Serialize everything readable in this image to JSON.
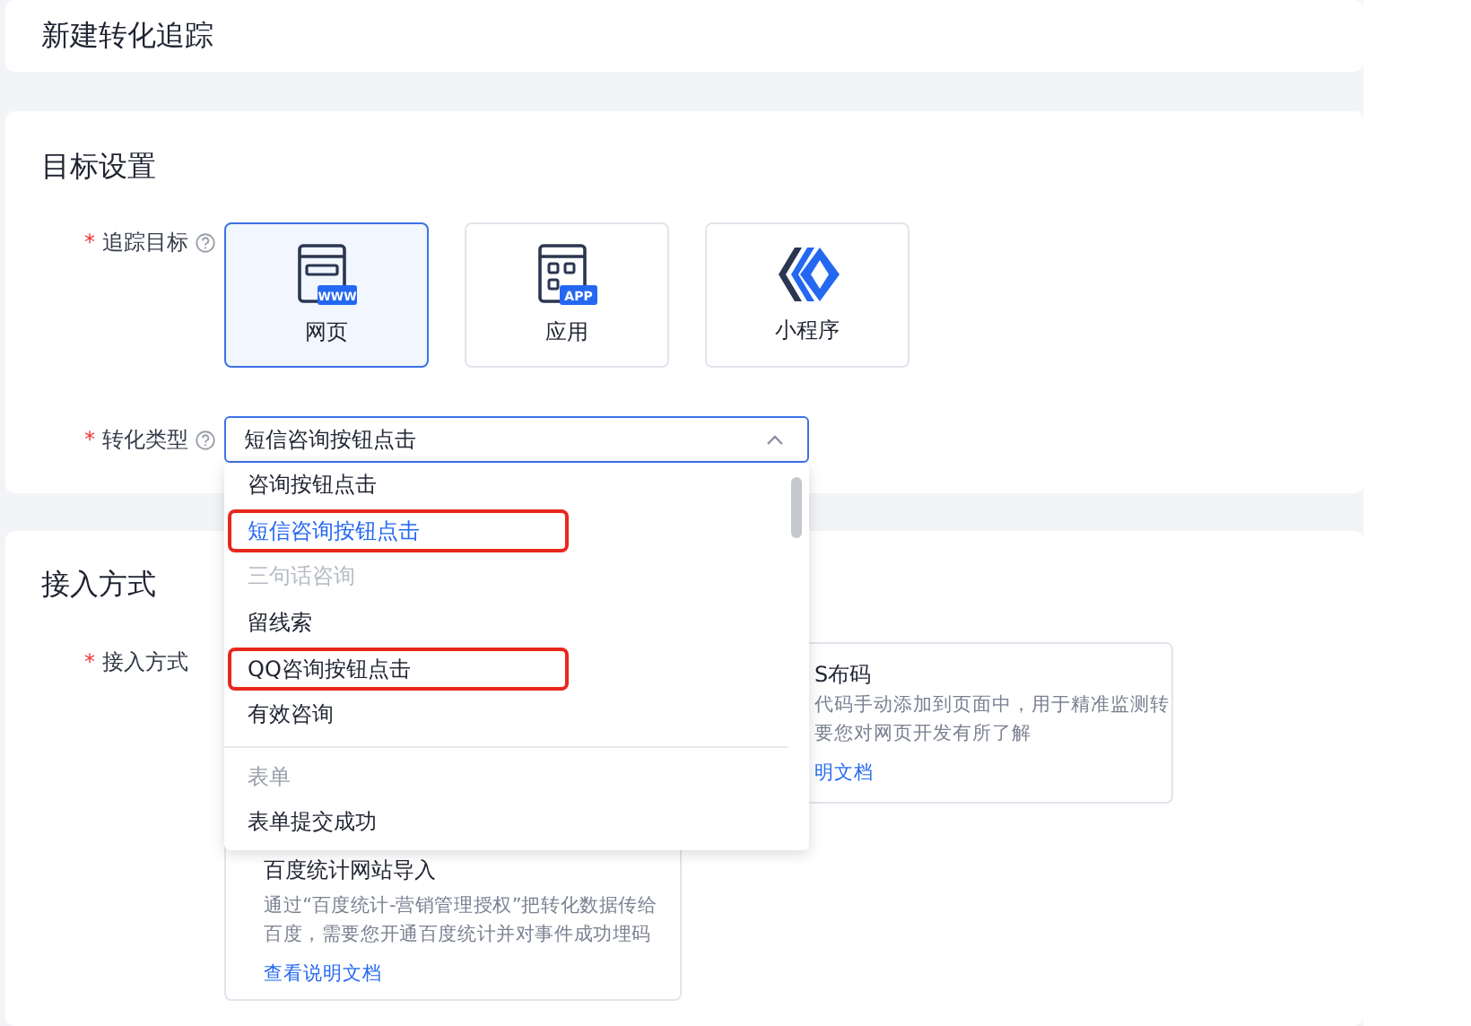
{
  "page_title": "新建转化追踪",
  "target_section": {
    "title": "目标设置",
    "track_target": {
      "required_mark": "*",
      "label": "追踪目标",
      "options": [
        {
          "kind": "web",
          "label": "网页",
          "badge": "WWW",
          "selected": true
        },
        {
          "kind": "app",
          "label": "应用",
          "badge": "APP",
          "selected": false
        },
        {
          "kind": "miniprogram",
          "label": "小程序",
          "selected": false
        }
      ]
    },
    "conversion_type": {
      "required_mark": "*",
      "label": "转化类型",
      "value": "短信咨询按钮点击",
      "expanded": true
    }
  },
  "dropdown": {
    "options": [
      {
        "kind": "option",
        "label": "咨询按钮点击",
        "selected": false,
        "disabled": false,
        "highlighted": false
      },
      {
        "kind": "option",
        "label": "短信咨询按钮点击",
        "selected": true,
        "disabled": false,
        "highlighted": true
      },
      {
        "kind": "option",
        "label": "三句话咨询",
        "selected": false,
        "disabled": true,
        "highlighted": false
      },
      {
        "kind": "option",
        "label": "留线索",
        "selected": false,
        "disabled": false,
        "highlighted": false
      },
      {
        "kind": "option",
        "label": "QQ咨询按钮点击",
        "selected": false,
        "disabled": false,
        "highlighted": true
      },
      {
        "kind": "option",
        "label": "有效咨询",
        "selected": false,
        "disabled": false,
        "highlighted": false
      },
      {
        "kind": "group",
        "label": "表单"
      },
      {
        "kind": "option",
        "label": "表单提交成功",
        "selected": false,
        "disabled": false,
        "highlighted": false
      }
    ]
  },
  "access_section": {
    "title": "接入方式",
    "required_mark": "*",
    "label": "接入方式",
    "cards": [
      {
        "title": "S布码",
        "description": [
          "代码手动添加到页面中，用于精准监测转",
          "要您对网页开发有所了解"
        ],
        "link": "明文档"
      },
      {
        "title": "百度统计网站导入",
        "description": [
          "通过“百度统计-营销管理授权”把转化数据传给百度，需要您开通百度统计并对事件成功埋码"
        ],
        "link": "查看说明文档"
      }
    ]
  }
}
